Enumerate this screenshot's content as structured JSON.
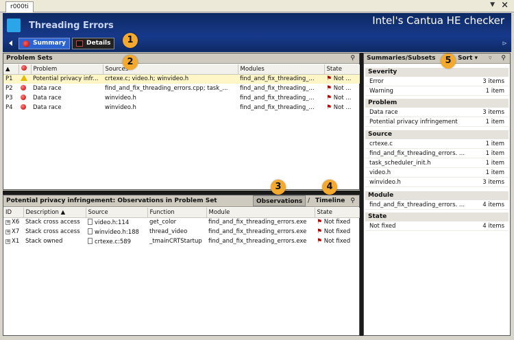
{
  "tab": {
    "label": "r000ti"
  },
  "header": {
    "app_title": "Threading Errors",
    "product_title": "Intel's Cantua HE checker",
    "summary_label": "Summary",
    "details_label": "Details"
  },
  "callouts": [
    "1",
    "2",
    "3",
    "4",
    "5"
  ],
  "problem_sets": {
    "title": "Problem Sets",
    "columns": [
      "",
      "",
      "Problem",
      "Sources",
      "Modules",
      "State"
    ],
    "rows": [
      {
        "id": "P1",
        "icon": "warning-icon",
        "problem": "Potential privacy infr...",
        "sources": "crtexe.c; video.h; winvideo.h",
        "modules": "find_and_fix_threading_...",
        "state": "Not ..."
      },
      {
        "id": "P2",
        "icon": "error-icon",
        "problem": "Data race",
        "sources": "find_and_fix_threading_errors.cpp; task_...",
        "modules": "find_and_fix_threading_...",
        "state": "Not ..."
      },
      {
        "id": "P3",
        "icon": "error-icon",
        "problem": "Data race",
        "sources": "winvideo.h",
        "modules": "find_and_fix_threading_...",
        "state": "Not ..."
      },
      {
        "id": "P4",
        "icon": "error-icon",
        "problem": "Data race",
        "sources": "winvideo.h",
        "modules": "find_and_fix_threading_...",
        "state": "Not ..."
      }
    ]
  },
  "observations": {
    "title": "Potential privacy infringement: Observations in Problem Set",
    "tab_observations": "Observations",
    "separator": "/",
    "tab_timeline": "Timeline",
    "columns": [
      "ID",
      "Description",
      "Source",
      "Function",
      "Module",
      "State"
    ],
    "rows": [
      {
        "id": "X6",
        "description": "Stack cross access",
        "source": "video.h:114",
        "function": "get_color",
        "module": "find_and_fix_threading_errors.exe",
        "state": "Not fixed"
      },
      {
        "id": "X7",
        "description": "Stack cross access",
        "source": "winvideo.h:188",
        "function": "thread_video",
        "module": "find_and_fix_threading_errors.exe",
        "state": "Not fixed"
      },
      {
        "id": "X1",
        "description": "Stack owned",
        "source": "crtexe.c:589",
        "function": "_tmainCRTStartup",
        "module": "find_and_fix_threading_errors.exe",
        "state": "Not fixed"
      }
    ]
  },
  "summaries": {
    "title": "Summaries/Subsets",
    "sort_label": "Sort",
    "groups": [
      {
        "title": "Severity",
        "rows": [
          {
            "label": "Error",
            "count": "3 items"
          },
          {
            "label": "Warning",
            "count": "1 item"
          }
        ]
      },
      {
        "title": "Problem",
        "rows": [
          {
            "label": "Data race",
            "count": "3 items"
          },
          {
            "label": "Potential privacy infringement",
            "count": "1 item"
          }
        ]
      },
      {
        "title": "Source",
        "rows": [
          {
            "label": "crtexe.c",
            "count": "1 item"
          },
          {
            "label": "find_and_fix_threading_errors. ...",
            "count": "1 item"
          },
          {
            "label": "task_scheduler_init.h",
            "count": "1 item"
          },
          {
            "label": "video.h",
            "count": "1 item"
          },
          {
            "label": "winvideo.h",
            "count": "3 items"
          }
        ]
      },
      {
        "title": "Module",
        "rows": [
          {
            "label": "find_and_fix_threading_errors. ...",
            "count": "4 items"
          }
        ]
      },
      {
        "title": "State",
        "rows": [
          {
            "label": "Not fixed",
            "count": "4 items"
          }
        ]
      }
    ]
  },
  "colors": {
    "header_bg": "#17398a",
    "accent": "#2b63d1",
    "callout": "#f3a92e",
    "error": "#c00000",
    "warning": "#e6b800"
  }
}
